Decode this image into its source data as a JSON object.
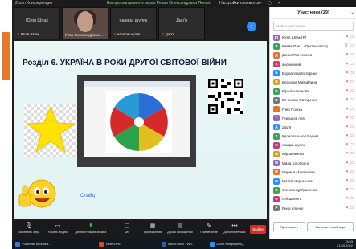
{
  "titlebar": {
    "app": "Zoom Конференция",
    "notice": "Вы просматриваете экран Ревва Олександрівна Пенюк",
    "view_settings": "Настройки просмотра"
  },
  "video_strip": {
    "tiles": [
      {
        "name": "Юлія Шпак",
        "sub": "Юлія Шпак"
      },
      {
        "name": "",
        "sub": "Рева Олександрівна ..."
      },
      {
        "name": "назари шуляк",
        "sub": "назари шуляк"
      },
      {
        "name": "Дар'я",
        "sub": "Дар'я"
      }
    ],
    "badge": "Запись"
  },
  "slide": {
    "title": "Розділ 6. УКРАЇНА В РОКИ ДРУГОЇ СВІТОВОЇ ВІЙНИ",
    "link": "Слайд"
  },
  "toolbar": {
    "items": [
      {
        "label": "Включить звук",
        "icon": "mic-muted-icon"
      },
      {
        "label": "Начать видео",
        "icon": "video-off-icon"
      },
      {
        "label": "Демонстрация экрана",
        "icon": "share-screen-icon"
      },
      {
        "label": "Чат",
        "icon": "chat-icon"
      },
      {
        "label": "Приложения",
        "icon": "apps-icon"
      },
      {
        "label": "Доска сообщений",
        "icon": "whiteboard-icon"
      },
      {
        "label": "Примечание",
        "icon": "note-icon"
      },
      {
        "label": "Дополнительно",
        "icon": "more-icon"
      }
    ],
    "end": "Выйти"
  },
  "participants": {
    "header": "Участники (29)",
    "search_placeholder": "Найти участника",
    "list": [
      {
        "name": "Юлія Шпак (Я)",
        "color": "#8e6bbf",
        "initial": "Ю"
      },
      {
        "name": "Ревва Оле... (Организатор)",
        "color": "#3aa35a",
        "initial": "Р"
      },
      {
        "name": "Данил Пантелеев",
        "color": "#e0762a",
        "initial": "Д"
      },
      {
        "name": "анонимний",
        "color": "#c43d7a",
        "initial": "А"
      },
      {
        "name": "Бориалова Катерина",
        "color": "#2d8cff",
        "initial": "Б"
      },
      {
        "name": "Вероніка Михайлина",
        "color": "#d3a12a",
        "initial": "В"
      },
      {
        "name": "Віра Молчанова",
        "color": "#3aa35a",
        "initial": "В"
      },
      {
        "name": "Вячеслав Овчаренко",
        "color": "#777777",
        "initial": "В"
      },
      {
        "name": "Глеб Поліха",
        "color": "#e0762a",
        "initial": "Г"
      },
      {
        "name": "Гевицков лев",
        "color": "#8e6bbf",
        "initial": "Г"
      },
      {
        "name": "Дар'я",
        "color": "#2d8cff",
        "initial": "Д"
      },
      {
        "name": "Кроиопальнов Вадим",
        "color": "#3aa35a",
        "initial": "К"
      },
      {
        "name": "назари шуляк",
        "color": "#c43d7a",
        "initial": "Н"
      },
      {
        "name": "Мірошнико Б",
        "color": "#d3a12a",
        "initial": "М"
      },
      {
        "name": "Мила Білобрича",
        "color": "#8e6bbf",
        "initial": "М"
      },
      {
        "name": "Марина Макаровна",
        "color": "#e0762a",
        "initial": "М"
      },
      {
        "name": "Матвій Чернышов",
        "color": "#2d8cff",
        "initial": "М"
      },
      {
        "name": "Олександр Гриценко",
        "color": "#3aa35a",
        "initial": "О"
      },
      {
        "name": "Олі Шипота",
        "color": "#c43d7a",
        "initial": "О"
      },
      {
        "name": "Рина Кличко",
        "color": "#777777",
        "initial": "Р"
      },
      {
        "name": "Софія Фролова",
        "color": "#e0762a",
        "initial": "С"
      },
      {
        "name": "Світлана",
        "color": "#3aa35a",
        "initial": "С"
      }
    ],
    "invite": "Пригласить",
    "mute_all": "Включить свой звук"
  },
  "taskbar": {
    "items": [
      {
        "label": "Участник публика...",
        "color": "#3a7bd5"
      },
      {
        "label": "TurboVPN",
        "color": "#d94a2a"
      },
      {
        "label": "сайти.docx - Wo...",
        "color": "#2b5fb3"
      },
      {
        "label": "Zoom Конференц...",
        "color": "#2d8cff"
      }
    ],
    "time": "13:03",
    "date": "21.03.2022"
  }
}
